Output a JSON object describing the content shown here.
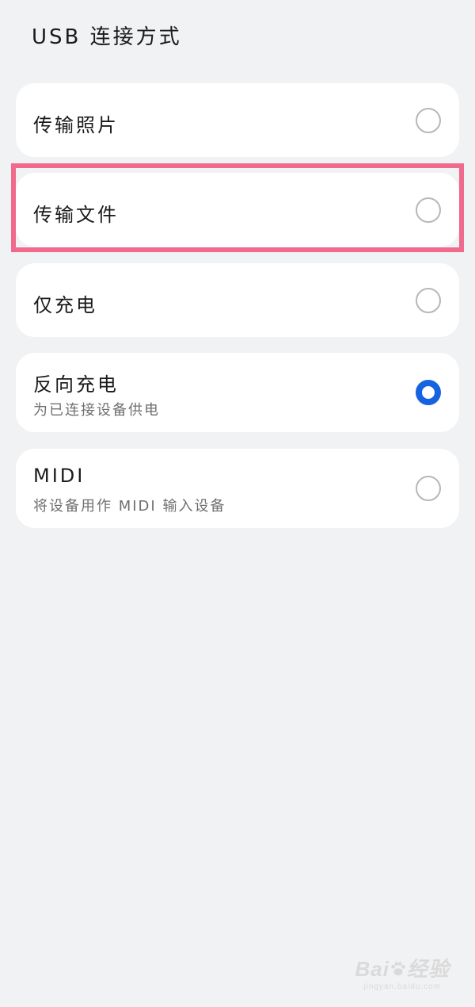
{
  "header": {
    "title": "USB 连接方式"
  },
  "options": [
    {
      "title": "传输照片",
      "subtitle": "",
      "selected": false
    },
    {
      "title": "传输文件",
      "subtitle": "",
      "selected": false,
      "highlighted": true
    },
    {
      "title": "仅充电",
      "subtitle": "",
      "selected": false
    },
    {
      "title": "反向充电",
      "subtitle": "为已连接设备供电",
      "selected": true
    },
    {
      "title": "MIDI",
      "subtitle": "将设备用作 MIDI 输入设备",
      "selected": false
    }
  ],
  "colors": {
    "background": "#f1f2f4",
    "card": "#ffffff",
    "accent": "#1663e0",
    "highlight": "#f06a8d"
  },
  "watermark": {
    "brand_left": "Bai",
    "brand_right": "经验",
    "url": "jingyan.baidu.com",
    "icon": "paw-icon"
  }
}
